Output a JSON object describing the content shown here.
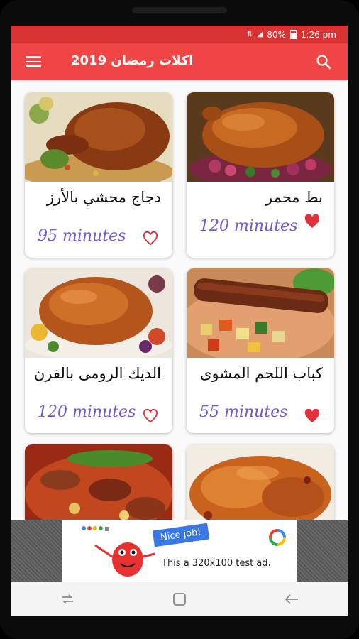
{
  "status_bar": {
    "battery": "80%",
    "time": "1:26 pm"
  },
  "app_bar": {
    "title": "اكلات رمضان 2019",
    "menu_icon": "hamburger-menu-icon",
    "search_icon": "search-icon"
  },
  "recipes": [
    {
      "name": "بط محمر",
      "minutes": "120 minutes",
      "favorite": true,
      "image": "roast-duck"
    },
    {
      "name": "دجاج محشي بالأرز",
      "minutes": "95 minutes",
      "favorite": false,
      "image": "stuffed-chicken-rice"
    },
    {
      "name": "كباب اللحم المشوى",
      "minutes": "55 minutes",
      "favorite": true,
      "image": "grilled-kebab"
    },
    {
      "name": "الديك الرومى بالفرن",
      "minutes": "120 minutes",
      "favorite": false,
      "image": "roast-turkey"
    },
    {
      "name": "",
      "minutes": "",
      "favorite": false,
      "image": "grilled-chicken"
    },
    {
      "name": "",
      "minutes": "",
      "favorite": false,
      "image": "meat-stew"
    }
  ],
  "ad": {
    "badge": "Nice job!",
    "text": "This a 320x100 test ad."
  },
  "nav_bar": {
    "back_icon": "back-arrow-icon",
    "home_icon": "home-square-icon",
    "recents_icon": "recents-icon"
  },
  "colors": {
    "accent": "#ef4545",
    "status_bar": "#d83232",
    "minutes_text": "#6b5cd2",
    "heart": "#e0303a"
  }
}
